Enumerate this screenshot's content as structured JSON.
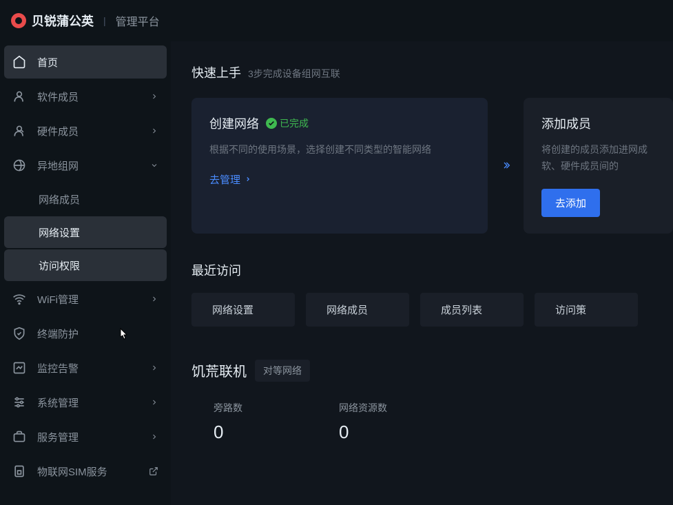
{
  "header": {
    "brand_name": "贝锐蒲公英",
    "brand_suffix": "管理平台"
  },
  "sidebar": {
    "home": "首页",
    "software_members": "软件成员",
    "hardware_members": "硬件成员",
    "remote_network": "异地组网",
    "network_members": "网络成员",
    "network_settings": "网络设置",
    "access_control": "访问权限",
    "wifi_management": "WiFi管理",
    "endpoint_protection": "终端防护",
    "monitoring_alerts": "监控告警",
    "system_management": "系统管理",
    "service_management": "服务管理",
    "iot_sim_service": "物联网SIM服务"
  },
  "quick_start": {
    "title": "快速上手",
    "subtitle": "3步完成设备组网互联",
    "card1": {
      "title": "创建网络",
      "status": "已完成",
      "desc": "根据不同的使用场景，选择创建不同类型的智能网络",
      "link": "去管理"
    },
    "card2": {
      "title": "添加成员",
      "desc": "将创建的成员添加进网成软、硬件成员间的",
      "button": "去添加"
    }
  },
  "recent": {
    "title": "最近访问",
    "items": [
      "网络设置",
      "网络成员",
      "成员列表",
      "访问策"
    ]
  },
  "network": {
    "title": "饥荒联机",
    "type": "对等网络",
    "stat1_label": "旁路数",
    "stat1_value": "0",
    "stat2_label": "网络资源数",
    "stat2_value": "0"
  }
}
